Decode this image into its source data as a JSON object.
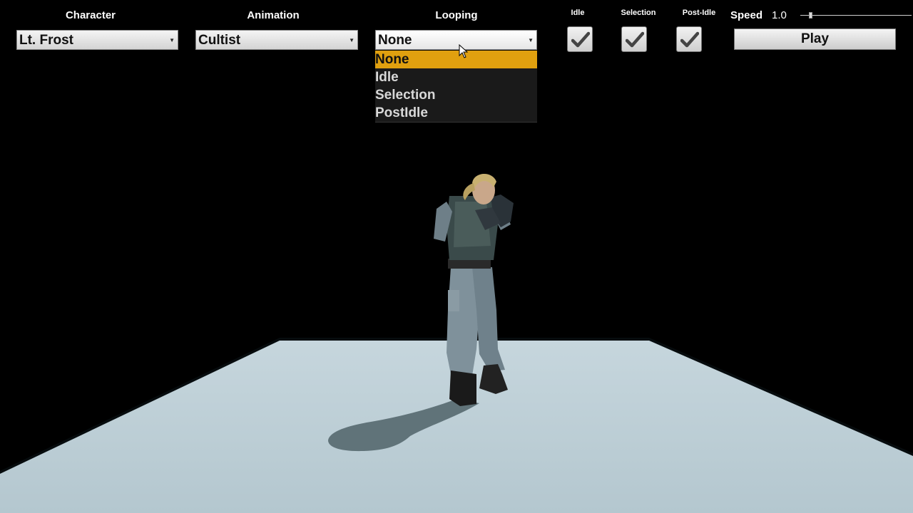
{
  "toolbar": {
    "character": {
      "label": "Character",
      "value": "Lt. Frost"
    },
    "animation": {
      "label": "Animation",
      "value": "Cultist"
    },
    "looping": {
      "label": "Looping",
      "value": "None",
      "options": [
        "None",
        "Idle",
        "Selection",
        "PostIdle"
      ],
      "selected_index": 0
    },
    "toggles": [
      {
        "label": "Idle",
        "checked": true
      },
      {
        "label": "Selection",
        "checked": true
      },
      {
        "label": "Post-Idle",
        "checked": true
      }
    ],
    "speed": {
      "label": "Speed",
      "value": "1.0"
    },
    "play_label": "Play"
  },
  "colors": {
    "selected_option_bg": "#e0a00f",
    "floor_light": "#c9dbe3",
    "floor_shadow": "#6a7c82"
  },
  "icons": {
    "checkbox": "checkmark-icon",
    "dropdown": "dropdown-arrow-icon",
    "cursor": "mouse-cursor-icon"
  }
}
